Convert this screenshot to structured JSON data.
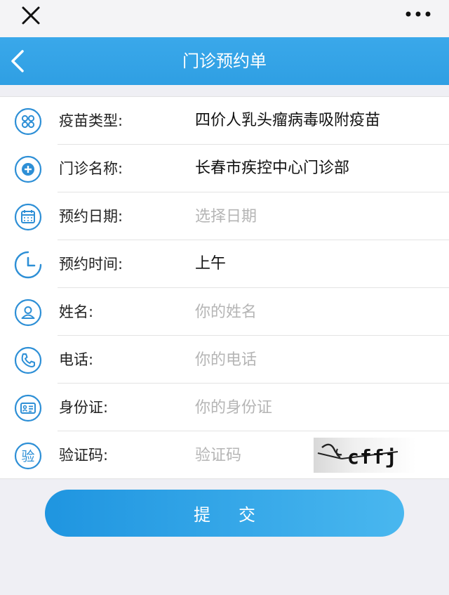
{
  "header": {
    "title": "门诊预约单"
  },
  "form": {
    "vaccine_type": {
      "label": "疫苗类型:",
      "value": "四价人乳头瘤病毒吸附疫苗",
      "icon": "grid-icon"
    },
    "clinic_name": {
      "label": "门诊名称:",
      "value": "长春市疾控中心门诊部",
      "icon": "plus-circle-icon"
    },
    "appointment_date": {
      "label": "预约日期:",
      "placeholder": "选择日期",
      "icon": "calendar-icon"
    },
    "appointment_time": {
      "label": "预约时间:",
      "value": "上午",
      "icon": "clock-icon"
    },
    "name": {
      "label": "姓名:",
      "placeholder": "你的姓名",
      "icon": "person-icon"
    },
    "phone": {
      "label": "电话:",
      "placeholder": "你的电话",
      "icon": "phone-icon"
    },
    "id_card": {
      "label": "身份证:",
      "placeholder": "你的身份证",
      "icon": "id-card-icon"
    },
    "captcha": {
      "label": "验证码:",
      "placeholder": "验证码",
      "icon_glyph": "验",
      "image_text": "cffj"
    }
  },
  "submit": {
    "label": "提交"
  },
  "colors": {
    "accent": "#2f9fe3",
    "icon": "#2d8fd6",
    "placeholder": "#b5b5b5"
  }
}
